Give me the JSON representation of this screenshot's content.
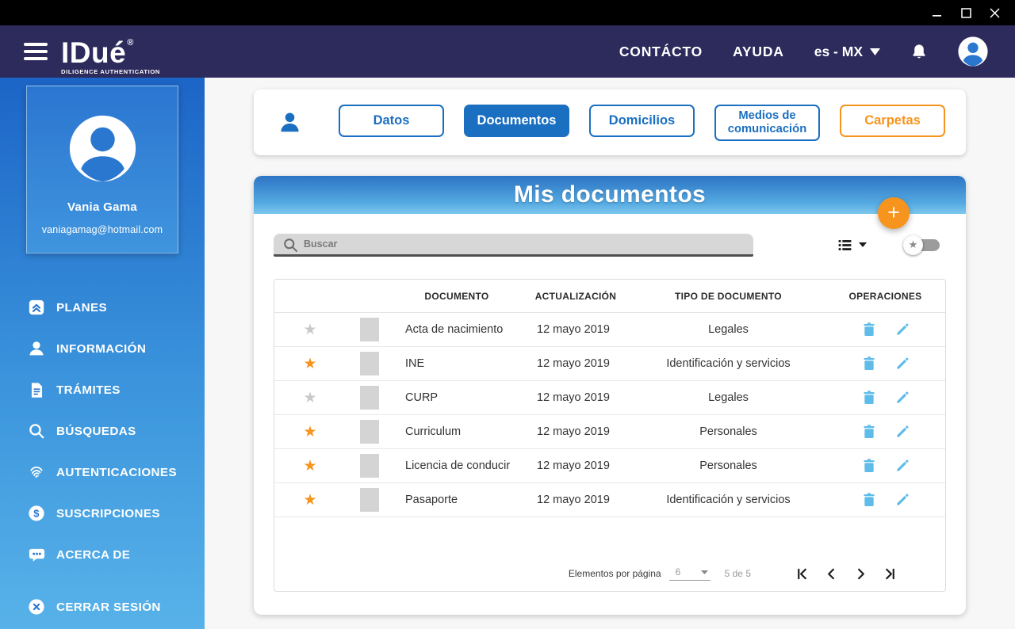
{
  "window": {
    "controls": [
      "minimize",
      "maximize",
      "close"
    ]
  },
  "header": {
    "brand": {
      "name": "IDué",
      "registered": "®",
      "tagline": "DILIGENCE AUTHENTICATION"
    },
    "contact_label": "CONTÁCTO",
    "help_label": "AYUDA",
    "language": "es - MX"
  },
  "sidebar": {
    "profile": {
      "name": "Vania Gama",
      "email": "vaniagamag@hotmail.com"
    },
    "items": [
      {
        "id": "planes",
        "label": "PLANES",
        "icon": "plans-icon"
      },
      {
        "id": "informacion",
        "label": "INFORMACIÓN",
        "icon": "person-icon"
      },
      {
        "id": "tramites",
        "label": "TRÁMITES",
        "icon": "document-icon"
      },
      {
        "id": "busquedas",
        "label": "BÚSQUEDAS",
        "icon": "search-icon"
      },
      {
        "id": "autenticaciones",
        "label": "AUTENTICACIONES",
        "icon": "fingerprint-icon"
      },
      {
        "id": "suscripciones",
        "label": "SUSCRIPCIONES",
        "icon": "dollar-icon"
      },
      {
        "id": "acerca-de",
        "label": "ACERCA DE",
        "icon": "chat-icon"
      },
      {
        "id": "cerrar-sesion",
        "label": "CERRAR SESIÓN",
        "icon": "logout-icon"
      }
    ]
  },
  "tabs": [
    {
      "id": "datos",
      "label": "Datos",
      "style": "outline-blue",
      "active": false
    },
    {
      "id": "documentos",
      "label": "Documentos",
      "style": "filled-blue",
      "active": true
    },
    {
      "id": "domicilios",
      "label": "Domicilios",
      "style": "outline-blue",
      "active": false
    },
    {
      "id": "medios-de-comunicacion",
      "label": "Medios de comunicación",
      "style": "outline-blue",
      "wrap": true,
      "active": false
    },
    {
      "id": "carpetas",
      "label": "Carpetas",
      "style": "outline-orange",
      "active": false
    }
  ],
  "documents": {
    "title": "Mis documentos",
    "search_placeholder": "Buscar",
    "columns": {
      "document": "DOCUMENTO",
      "updated": "ACTUALIZACIÓN",
      "type": "TIPO DE DOCUMENTO",
      "operations": "OPERACIONES"
    },
    "rows": [
      {
        "starred": false,
        "name": "Acta de nacimiento",
        "updated": "12 mayo 2019",
        "type": "Legales"
      },
      {
        "starred": true,
        "name": "INE",
        "updated": "12 mayo 2019",
        "type": "Identificación y servicios"
      },
      {
        "starred": false,
        "name": "CURP",
        "updated": "12 mayo 2019",
        "type": "Legales"
      },
      {
        "starred": true,
        "name": "Curriculum",
        "updated": "12 mayo 2019",
        "type": "Personales"
      },
      {
        "starred": true,
        "name": "Licencia de conducir",
        "updated": "12 mayo 2019",
        "type": "Personales"
      },
      {
        "starred": true,
        "name": "Pasaporte",
        "updated": "12 mayo 2019",
        "type": "Identificación y servicios"
      }
    ],
    "add_button": "+",
    "pagination": {
      "label": "Elementos por página",
      "page_size": "6",
      "range": "5 de 5"
    }
  },
  "icons": [
    "menu-icon",
    "bell-icon",
    "user-avatar-icon",
    "view-list-icon",
    "favorites-toggle-star-icon",
    "search-icon",
    "delete-icon",
    "edit-icon",
    "first-page-icon",
    "previous-page-icon",
    "next-page-icon",
    "last-page-icon",
    "add-icon"
  ],
  "colors": {
    "titlebar_black": "#000000",
    "header_navy": "#2d2a5c",
    "primary_blue": "#1b6fc0",
    "sidebar_gradient_top": "#1c65c7",
    "sidebar_gradient_bottom": "#58b2e9",
    "card_header_gradient_top": "#2c74c4",
    "card_header_gradient_bottom": "#7ec8ee",
    "accent_orange": "#f7941d",
    "action_icon_blue": "#5fbce9",
    "star_inactive_gray": "#c9c9c9"
  }
}
